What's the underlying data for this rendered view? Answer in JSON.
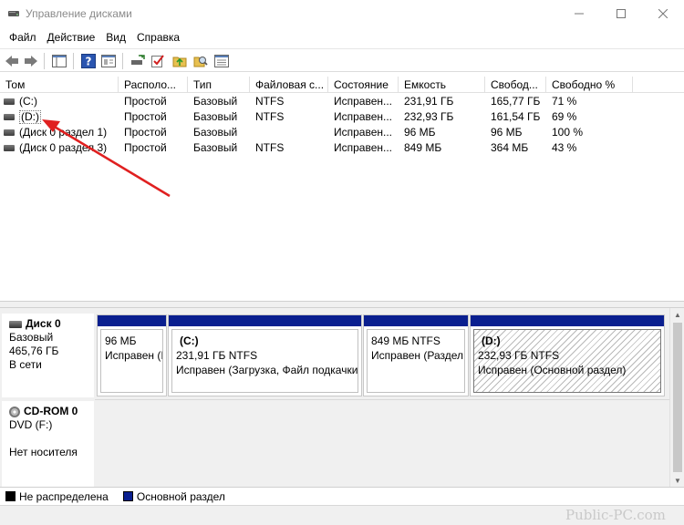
{
  "window": {
    "title": "Управление дисками"
  },
  "menu": [
    "Файл",
    "Действие",
    "Вид",
    "Справка"
  ],
  "columns": [
    "Том",
    "Располо...",
    "Тип",
    "Файловая с...",
    "Состояние",
    "Емкость",
    "Свобод...",
    "Свободно %"
  ],
  "volumes": [
    {
      "name": "(C:)",
      "layout": "Простой",
      "type": "Базовый",
      "fs": "NTFS",
      "status": "Исправен...",
      "capacity": "231,91 ГБ",
      "free": "165,77 ГБ",
      "free_pct": "71 %"
    },
    {
      "name": "(D:)",
      "layout": "Простой",
      "type": "Базовый",
      "fs": "NTFS",
      "status": "Исправен...",
      "capacity": "232,93 ГБ",
      "free": "161,54 ГБ",
      "free_pct": "69 %"
    },
    {
      "name": "(Диск 0 раздел 1)",
      "layout": "Простой",
      "type": "Базовый",
      "fs": "",
      "status": "Исправен...",
      "capacity": "96 МБ",
      "free": "96 МБ",
      "free_pct": "100 %"
    },
    {
      "name": "(Диск 0 раздел 3)",
      "layout": "Простой",
      "type": "Базовый",
      "fs": "NTFS",
      "status": "Исправен...",
      "capacity": "849 МБ",
      "free": "364 МБ",
      "free_pct": "43 %"
    }
  ],
  "disks": [
    {
      "name": "Диск 0",
      "type": "Базовый",
      "size": "465,76 ГБ",
      "status": "В сети",
      "partitions": [
        {
          "name": "",
          "size": "96 МБ",
          "status": "Исправен (I"
        },
        {
          "name": "(C:)",
          "size": "231,91 ГБ NTFS",
          "status": "Исправен (Загрузка, Файл подкачки"
        },
        {
          "name": "",
          "size": "849 МБ NTFS",
          "status": "Исправен (Раздел"
        },
        {
          "name": "(D:)",
          "size": "232,93 ГБ NTFS",
          "status": "Исправен (Основной раздел)"
        }
      ]
    },
    {
      "name": "CD-ROM 0",
      "type": "DVD (F:)",
      "status": "Нет носителя"
    }
  ],
  "legend": [
    {
      "label": "Не распределена",
      "color": "#000000"
    },
    {
      "label": "Основной раздел",
      "color": "#0a1f8f"
    }
  ],
  "watermark": "Public-PC.com",
  "colors": {
    "partition_header": "#0a1f8f",
    "arrow": "#e02020"
  }
}
